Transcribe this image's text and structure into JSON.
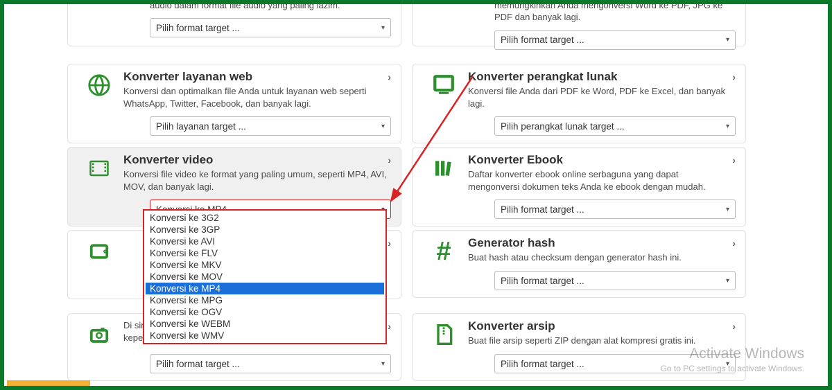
{
  "cards": {
    "audio": {
      "desc": "Konverter audio online serbaguna yang mengonversi file audio dalam format file audio yang paling lazim.",
      "select": "Pilih format target ..."
    },
    "doc": {
      "desc": "Pemilihan konverter dokumen gratis kami yang memungkinkan Anda mengonversi Word ke PDF, JPG ke PDF dan banyak lagi.",
      "select": "Pilih format target ..."
    },
    "web": {
      "title": "Konverter layanan web",
      "desc": "Konversi dan optimalkan file Anda untuk layanan web seperti WhatsApp, Twitter, Facebook, dan banyak lagi.",
      "select": "Pilih layanan target ..."
    },
    "soft": {
      "title": "Konverter perangkat lunak",
      "desc": "Konversi file Anda dari PDF ke Word, PDF ke Excel, dan banyak lagi.",
      "select": "Pilih perangkat lunak target ..."
    },
    "video": {
      "title": "Konverter video",
      "desc": "Konversi file video ke format yang paling umum, seperti MP4, AVI, MOV, dan banyak lagi.",
      "select": "Konversi ke MP4"
    },
    "ebook": {
      "title": "Konverter Ebook",
      "desc": "Daftar konverter ebook online serbaguna yang dapat mengonversi dokumen teks Anda ke ebook dengan mudah.",
      "select": "Pilih format target ..."
    },
    "device": {
      "title": "",
      "desc": "",
      "select": ""
    },
    "hash": {
      "title": "Generator hash",
      "desc": "Buat hash atau checksum dengan generator hash ini.",
      "select": "Pilih format target ..."
    },
    "image": {
      "title": "",
      "desc": "Di sini, Anda dapat menemukan konverter gambar untuk keperluan Anda, misalnya, konverter PDF ke gambar.",
      "select": "Pilih format target ..."
    },
    "archive": {
      "title": "Konverter arsip",
      "desc": "Buat file arsip seperti ZIP dengan alat kompresi gratis ini.",
      "select": "Pilih format target ..."
    }
  },
  "dropdown": {
    "options": [
      "Konversi ke 3G2",
      "Konversi ke 3GP",
      "Konversi ke AVI",
      "Konversi ke FLV",
      "Konversi ke MKV",
      "Konversi ke MOV",
      "Konversi ke MP4",
      "Konversi ke MPG",
      "Konversi ke OGV",
      "Konversi ke WEBM",
      "Konversi ke WMV"
    ],
    "selected": "Konversi ke MP4"
  },
  "watermark": {
    "title": "Activate Windows",
    "sub": "Go to PC settings to activate Windows."
  }
}
